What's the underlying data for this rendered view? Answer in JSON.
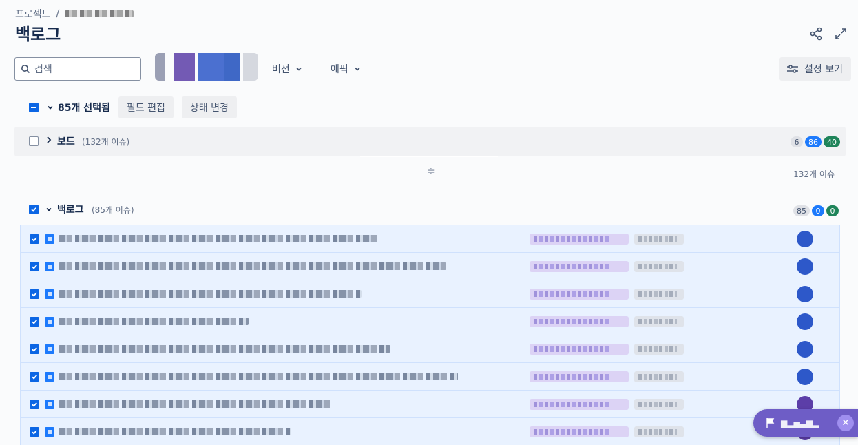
{
  "breadcrumb": {
    "root": "프로젝트",
    "separator": "/"
  },
  "page_title": "백로그",
  "toolbar": {
    "search_placeholder": "검색",
    "version_label": "버전",
    "epic_label": "에픽",
    "settings_label": "설정 보기"
  },
  "selection": {
    "count_text": "85개 선택됨",
    "edit_fields_label": "필드 편집",
    "change_status_label": "상태 변경"
  },
  "board_section": {
    "title": "보드",
    "count_text": "(132개 이슈)",
    "badges": {
      "todo": "6",
      "in_progress": "86",
      "done": "40"
    }
  },
  "board_issue_total": "132개 이슈",
  "backlog_section": {
    "title": "백로그",
    "count_text": "(85개 이슈)",
    "badges": {
      "todo": "85",
      "in_progress": "0",
      "done": "0"
    }
  },
  "issues": [
    {
      "selected": true,
      "assignee_color": "#2d58c9"
    },
    {
      "selected": true,
      "assignee_color": "#2d58c9"
    },
    {
      "selected": true,
      "assignee_color": "#2d58c9"
    },
    {
      "selected": true,
      "assignee_color": "#2d58c9"
    },
    {
      "selected": true,
      "assignee_color": "#2d58c9"
    },
    {
      "selected": true,
      "assignee_color": "#2d58c9"
    },
    {
      "selected": true,
      "assignee_color": "#5c3ea8"
    },
    {
      "selected": true,
      "assignee_color": "#5c3ea8"
    }
  ],
  "colors": {
    "accent": "#0c66e4",
    "selected_row": "#e9f2ff",
    "floating": "#6e5dc6"
  }
}
